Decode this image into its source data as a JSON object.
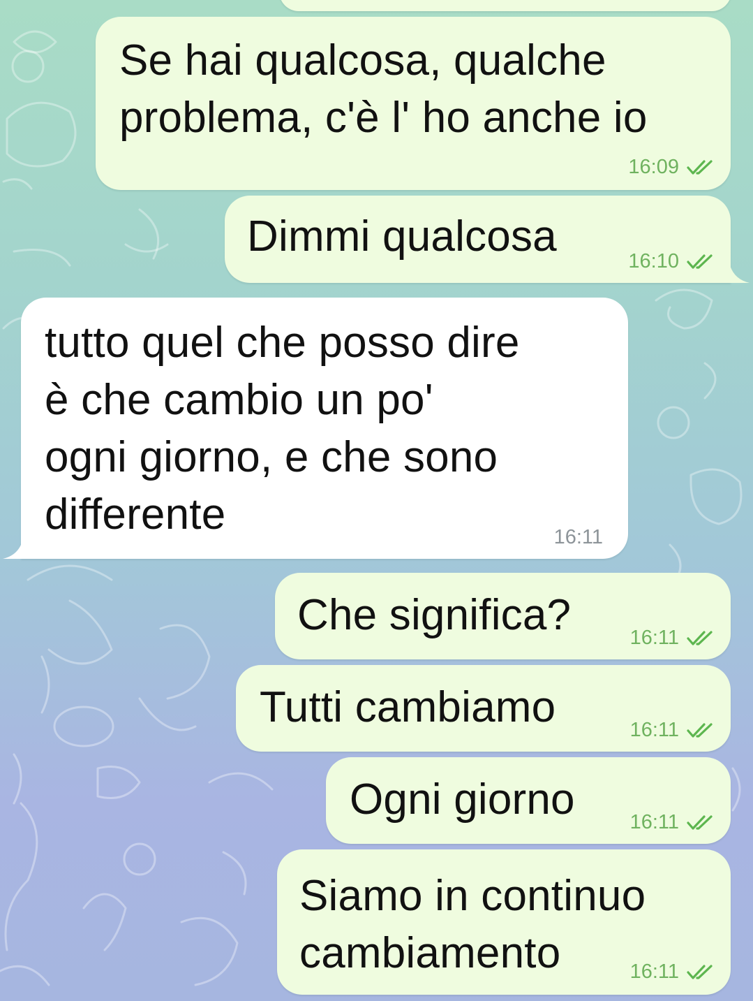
{
  "chat": {
    "background_gradient": [
      "#a9dcc6",
      "#a3d4cd",
      "#a2c8d8",
      "#a9b5e2"
    ],
    "outgoing_color": "#effcdf",
    "incoming_color": "#ffffff",
    "messages": [
      {
        "direction": "out",
        "text": "Se hai qualcosa, qualche\nproblema, c'è l' ho anche io",
        "time": "16:09",
        "status": "read"
      },
      {
        "direction": "out",
        "text": "Dimmi qualcosa",
        "time": "16:10",
        "status": "read"
      },
      {
        "direction": "in",
        "text": "tutto quel che posso dire\nè che cambio un po'\nogni giorno, e che sono\ndifferente",
        "time": "16:11"
      },
      {
        "direction": "out",
        "text": "Che significa?",
        "time": "16:11",
        "status": "read"
      },
      {
        "direction": "out",
        "text": "Tutti cambiamo",
        "time": "16:11",
        "status": "read"
      },
      {
        "direction": "out",
        "text": "Ogni giorno",
        "time": "16:11",
        "status": "read"
      },
      {
        "direction": "out",
        "text": "Siamo in continuo\ncambiamento",
        "time": "16:11",
        "status": "read"
      }
    ]
  }
}
